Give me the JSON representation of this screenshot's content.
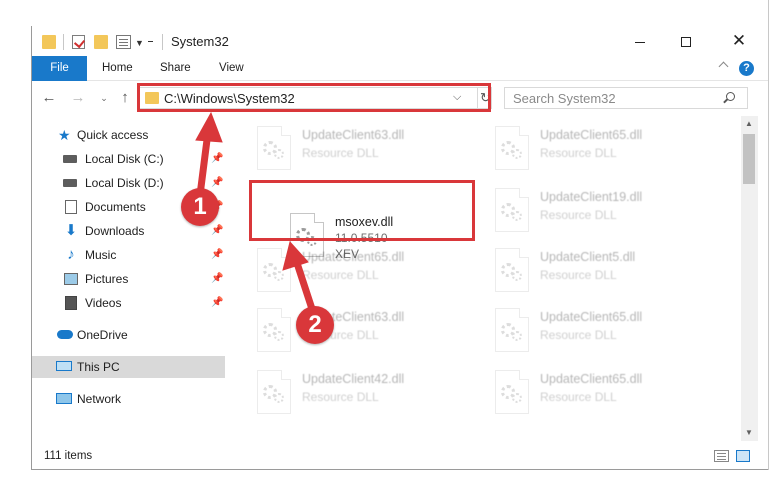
{
  "window": {
    "title": "System32",
    "minimize_icon": "minimize-icon",
    "maximize_icon": "maximize-icon",
    "close_glyph": "✕"
  },
  "ribbon": {
    "tabs": [
      "File",
      "Home",
      "Share",
      "View"
    ],
    "help_glyph": "?"
  },
  "address": {
    "path": "C:\\Windows\\System32",
    "dropdown_glyph": "⌵",
    "refresh_glyph": "↻"
  },
  "search": {
    "placeholder": "Search System32"
  },
  "nav": {
    "back_glyph": "←",
    "forward_glyph": "→",
    "recent_glyph": "⌄",
    "up_glyph": "↑"
  },
  "sidebar": {
    "items": [
      {
        "label": "Quick access",
        "icon": "star-icon"
      },
      {
        "label": "Local Disk (C:)",
        "icon": "disk-icon",
        "pinned": true
      },
      {
        "label": "Local Disk (D:)",
        "icon": "disk-icon",
        "pinned": true
      },
      {
        "label": "Documents",
        "icon": "documents-icon",
        "pinned": true
      },
      {
        "label": "Downloads",
        "icon": "downloads-icon",
        "pinned": true
      },
      {
        "label": "Music",
        "icon": "music-icon",
        "pinned": true
      },
      {
        "label": "Pictures",
        "icon": "pictures-icon",
        "pinned": true
      },
      {
        "label": "Videos",
        "icon": "videos-icon",
        "pinned": true
      },
      {
        "label": "OneDrive",
        "icon": "onedrive-icon"
      },
      {
        "label": "This PC",
        "icon": "this-pc-icon",
        "selected": true
      },
      {
        "label": "Network",
        "icon": "network-icon"
      }
    ]
  },
  "files": [
    {
      "name": "UpdateClient63.dll",
      "line1": "Resource DLL",
      "line2": ""
    },
    {
      "name": "UpdateClient65.dll",
      "line1": "Resource DLL",
      "line2": ""
    },
    {
      "name": "msoxev.dll",
      "line1": "11.0.5510",
      "line2": "XEV"
    },
    {
      "name": "UpdateClient19.dll",
      "line1": "Resource DLL",
      "line2": ""
    },
    {
      "name": "UpdateClient65.dll",
      "line1": "Resource DLL",
      "line2": ""
    },
    {
      "name": "UpdateClient5.dll",
      "line1": "Resource DLL",
      "line2": ""
    },
    {
      "name": "UpdateClient63.dll",
      "line1": "Resource DLL",
      "line2": ""
    },
    {
      "name": "UpdateClient65.dll",
      "line1": "Resource DLL",
      "line2": ""
    },
    {
      "name": "UpdateClient42.dll",
      "line1": "Resource DLL",
      "line2": ""
    },
    {
      "name": "UpdateClient65.dll",
      "line1": "Resource DLL",
      "line2": ""
    }
  ],
  "status": {
    "item_count": "111 items"
  },
  "annotations": {
    "marker_1": "1",
    "marker_2": "2",
    "color": "#d9373a"
  },
  "colors": {
    "accent": "#1979ca",
    "highlight": "#d9373a"
  }
}
